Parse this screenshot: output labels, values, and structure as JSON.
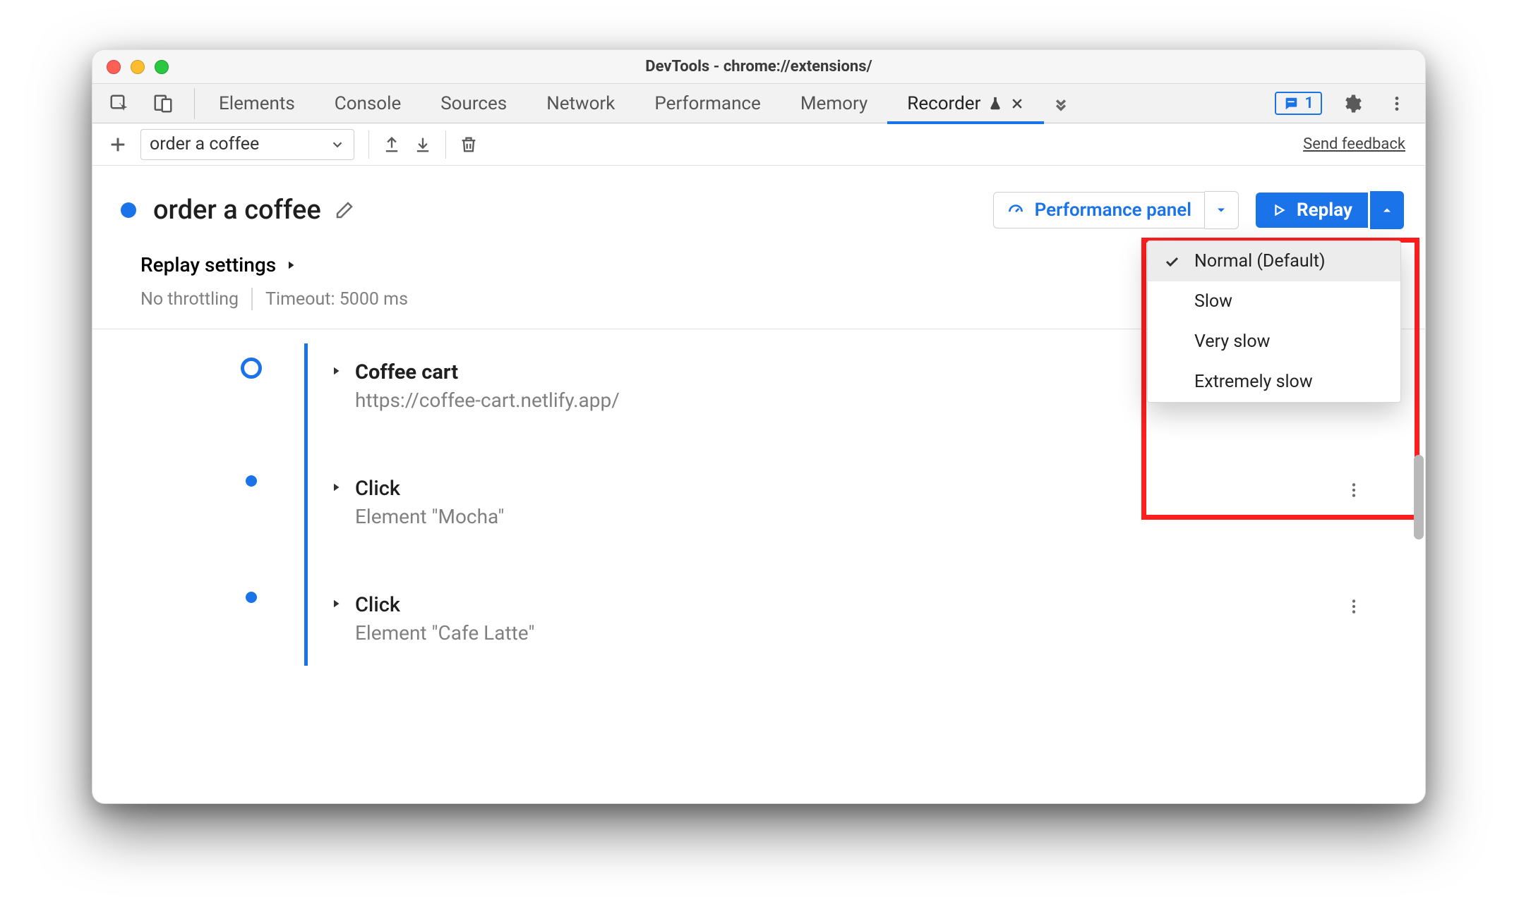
{
  "window": {
    "title": "DevTools - chrome://extensions/"
  },
  "tabs": {
    "items": [
      "Elements",
      "Console",
      "Sources",
      "Network",
      "Performance",
      "Memory",
      "Recorder"
    ],
    "active_index": 6,
    "issues_count": "1"
  },
  "toolbar": {
    "recording_select": "order a coffee",
    "feedback_label": "Send feedback"
  },
  "recorder": {
    "name": "order a coffee",
    "performance_panel_label": "Performance panel",
    "replay_label": "Replay"
  },
  "replay_menu": {
    "items": [
      "Normal (Default)",
      "Slow",
      "Very slow",
      "Extremely slow"
    ],
    "selected_index": 0
  },
  "settings": {
    "title": "Replay settings",
    "throttle": "No throttling",
    "timeout": "Timeout: 5000 ms"
  },
  "steps": [
    {
      "title": "Coffee cart",
      "subtitle": "https://coffee-cart.netlify.app/",
      "bold": true,
      "first": true
    },
    {
      "title": "Click",
      "subtitle": "Element \"Mocha\"",
      "bold": false,
      "first": false
    },
    {
      "title": "Click",
      "subtitle": "Element \"Cafe Latte\"",
      "bold": false,
      "first": false
    }
  ]
}
